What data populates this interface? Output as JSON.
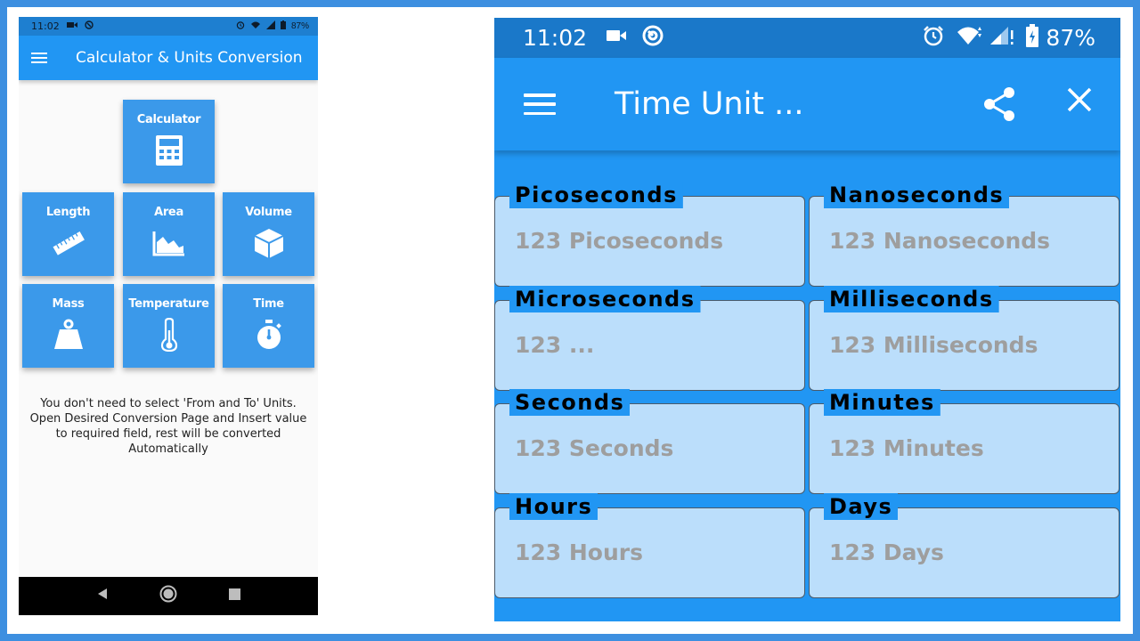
{
  "left_phone": {
    "status_bar": {
      "time": "11:02",
      "battery": "87%"
    },
    "app_bar": {
      "title": "Calculator & Units Conversion"
    },
    "tiles": [
      {
        "id": "calculator",
        "label": "Calculator",
        "icon": "calculator-icon"
      },
      {
        "id": "length",
        "label": "Length",
        "icon": "ruler-icon"
      },
      {
        "id": "area",
        "label": "Area",
        "icon": "area-chart-icon"
      },
      {
        "id": "volume",
        "label": "Volume",
        "icon": "cube-icon"
      },
      {
        "id": "mass",
        "label": "Mass",
        "icon": "weight-icon"
      },
      {
        "id": "temperature",
        "label": "Temperature",
        "icon": "thermometer-icon"
      },
      {
        "id": "time",
        "label": "Time",
        "icon": "stopwatch-icon"
      }
    ],
    "info": {
      "line1": "You don't need to select 'From and To' Units.",
      "line2": "Open Desired Conversion Page and Insert value",
      "line3": "to required field, rest will be converted",
      "line4": "Automatically"
    }
  },
  "right_phone": {
    "status_bar": {
      "time": "11:02",
      "battery": "87%"
    },
    "app_bar": {
      "title": "Time Unit ..."
    },
    "fields": [
      {
        "id": "picoseconds",
        "label": "Picoseconds",
        "placeholder": "123 Picoseconds"
      },
      {
        "id": "nanoseconds",
        "label": "Nanoseconds",
        "placeholder": "123 Nanoseconds"
      },
      {
        "id": "microseconds",
        "label": "Microseconds",
        "placeholder": "123 ..."
      },
      {
        "id": "milliseconds",
        "label": "Milliseconds",
        "placeholder": "123 Milliseconds"
      },
      {
        "id": "seconds",
        "label": "Seconds",
        "placeholder": "123 Seconds"
      },
      {
        "id": "minutes",
        "label": "Minutes",
        "placeholder": "123 Minutes"
      },
      {
        "id": "hours",
        "label": "Hours",
        "placeholder": "123 Hours"
      },
      {
        "id": "days",
        "label": "Days",
        "placeholder": "123 Days"
      }
    ]
  },
  "colors": {
    "primary": "#2196f3",
    "status_bar": "#1a78c9",
    "field_fill": "#bbdefb",
    "frame": "#3d8fe0"
  }
}
